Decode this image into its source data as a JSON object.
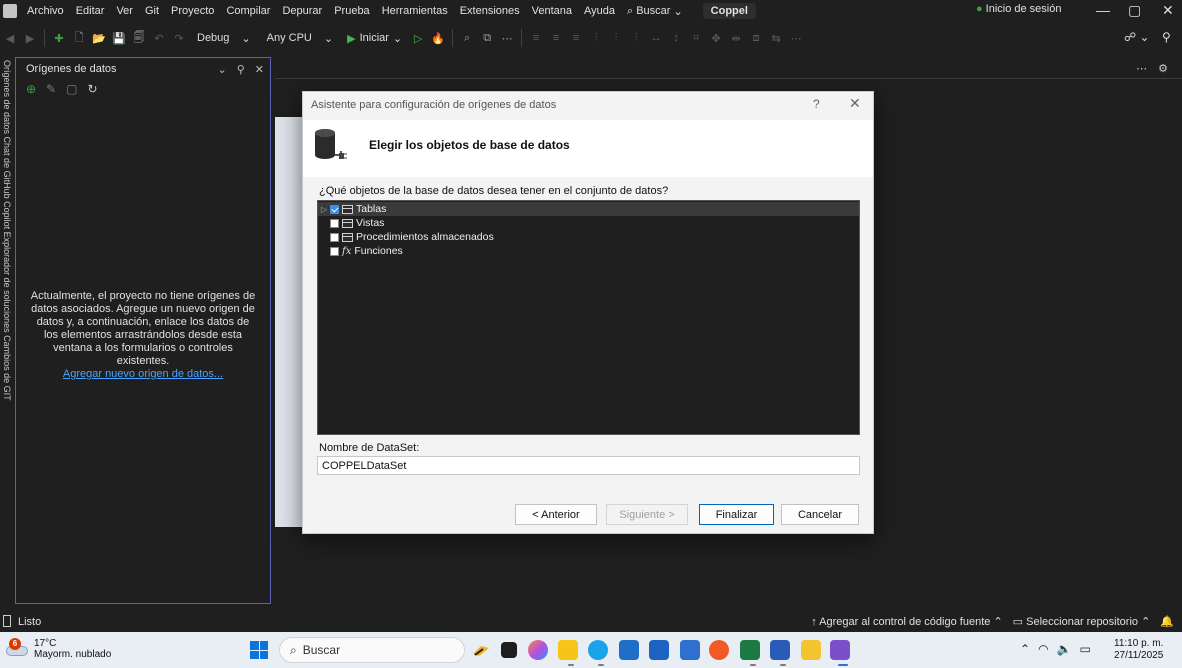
{
  "menubar": {
    "items": [
      "Archivo",
      "Editar",
      "Ver",
      "Git",
      "Proyecto",
      "Compilar",
      "Depurar",
      "Prueba",
      "Herramientas",
      "Extensiones",
      "Ventana",
      "Ayuda"
    ],
    "search_label": "Buscar",
    "project_name": "Coppel",
    "signin_label": "Inicio de sesión"
  },
  "toolbar": {
    "config": "Debug",
    "platform": "Any CPU",
    "start_label": "Iniciar"
  },
  "side_strip": {
    "text": "Orígenes de datos   Chat de GitHub Copilot   Explorador de soluciones   Cambios de GIT"
  },
  "datasources_panel": {
    "title": "Orígenes de datos",
    "message": "Actualmente, el proyecto no tiene orígenes de datos asociados. Agregue un nuevo origen de datos y, a continuación, enlace los datos de los elementos arrastrándolos desde esta ventana a los formularios o controles existentes.",
    "add_link": "Agregar nuevo origen de datos..."
  },
  "dialog": {
    "title": "Asistente para configuración de orígenes de datos",
    "help": "?",
    "close": "✕",
    "header_title": "Elegir los objetos de base de datos",
    "question": "¿Qué objetos de la base de datos desea tener en el conjunto de datos?",
    "tree": [
      {
        "label": "Tablas",
        "checked": true,
        "expandable": true,
        "icon": "table-icon",
        "selected": true
      },
      {
        "label": "Vistas",
        "checked": false,
        "expandable": false,
        "icon": "view-icon"
      },
      {
        "label": "Procedimientos almacenados",
        "checked": false,
        "expandable": false,
        "icon": "procedure-icon"
      },
      {
        "label": "Funciones",
        "checked": false,
        "expandable": false,
        "icon": "function-icon"
      }
    ],
    "dataset_label": "Nombre de DataSet:",
    "dataset_value": "COPPELDataSet",
    "buttons": {
      "back": "< Anterior",
      "next": "Siguiente >",
      "finish": "Finalizar",
      "cancel": "Cancelar"
    }
  },
  "statusbar": {
    "ready": "Listo",
    "add_source_control": "Agregar al control de código fuente",
    "select_repo": "Seleccionar repositorio"
  },
  "taskbar": {
    "weather_badge": "6",
    "temperature": "17°C",
    "weather_text": "Mayorm. nublado",
    "search_placeholder": "Buscar",
    "time": "11:10 p. m.",
    "date": "27/11/2025"
  }
}
